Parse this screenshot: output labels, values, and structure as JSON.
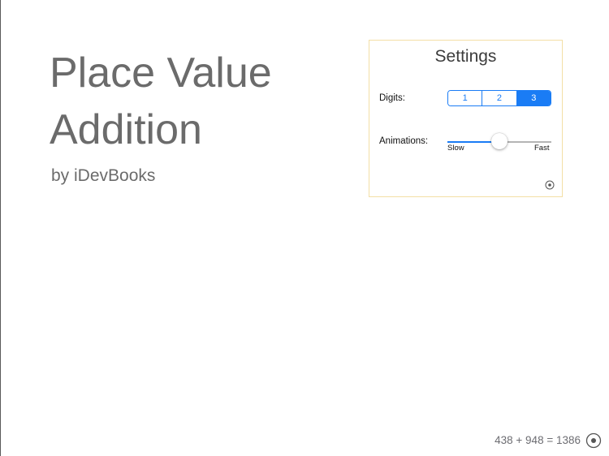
{
  "app": {
    "title_line_1": "Place Value",
    "title_line_2": "Addition",
    "byline": "by iDevBooks"
  },
  "settings": {
    "title": "Settings",
    "digits": {
      "label": "Digits:",
      "options": [
        "1",
        "2",
        "3"
      ],
      "selected": "3"
    },
    "animations": {
      "label": "Animations:",
      "min_label": "Slow",
      "max_label": "Fast",
      "value_fraction": 0.5
    },
    "info_icon": "info-circle-icon"
  },
  "footer": {
    "equation": "438 + 948 = 1386",
    "info_icon": "info-circle-icon"
  },
  "colors": {
    "accent": "#1a7cf5",
    "panel_border": "#f3dfa6",
    "text_gray": "#6b6b6b"
  }
}
